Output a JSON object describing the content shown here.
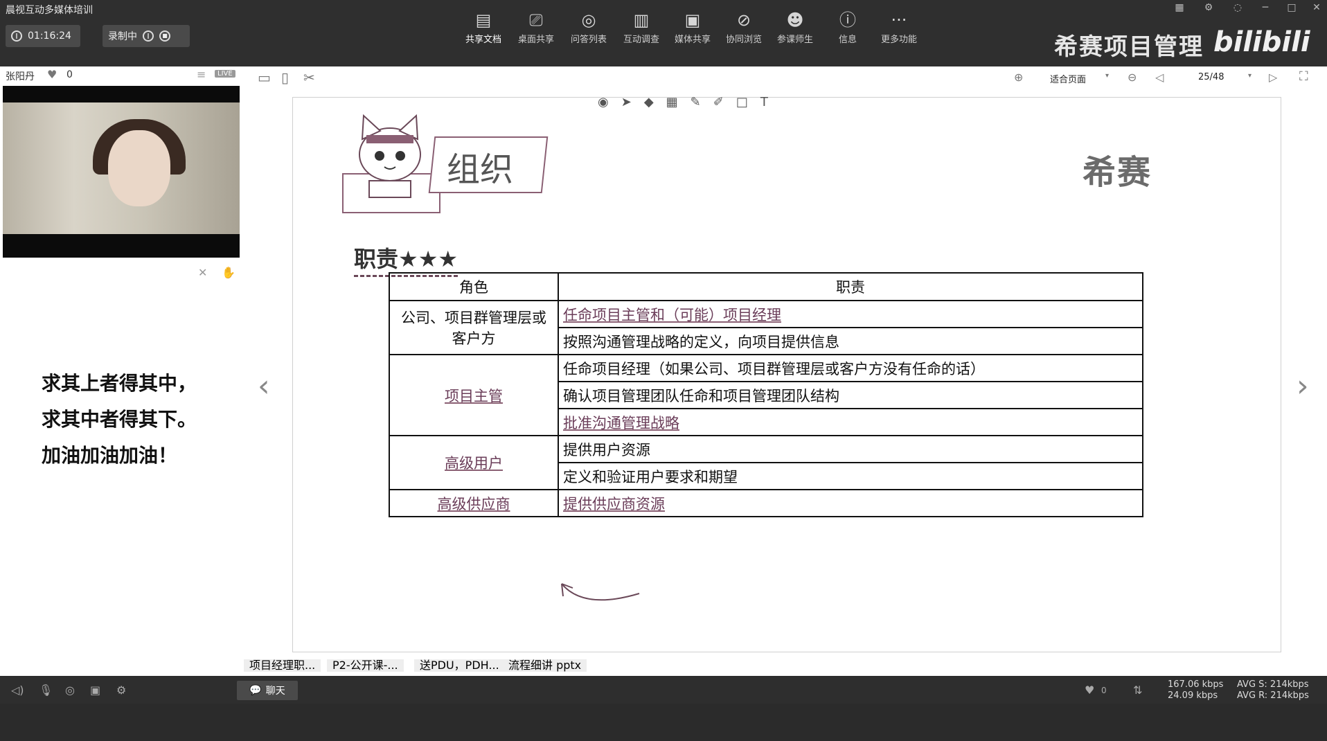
{
  "window": {
    "title": "晨视互动多媒体培训"
  },
  "recording": {
    "timer": "01:16:24",
    "status": "录制中"
  },
  "toolbar": [
    {
      "icon": "document-icon",
      "label": "共享文档"
    },
    {
      "icon": "desktop-share-icon",
      "label": "桌面共享"
    },
    {
      "icon": "qa-icon",
      "label": "问答列表"
    },
    {
      "icon": "survey-icon",
      "label": "互动调查"
    },
    {
      "icon": "media-icon",
      "label": "媒体共享"
    },
    {
      "icon": "browse-icon",
      "label": "协同浏览"
    },
    {
      "icon": "participants-icon",
      "label": "参课师生"
    },
    {
      "icon": "info-icon",
      "label": "信息"
    },
    {
      "icon": "more-icon",
      "label": "更多功能"
    }
  ],
  "brand": {
    "text": "希赛项目管理",
    "platform": "bilibili"
  },
  "presenter": {
    "name": "张阳丹",
    "likes": "0",
    "live_badge": "LIVE"
  },
  "motto": {
    "line1": "求其上者得其中，",
    "line2": "求其中者得其下。",
    "line3": "加油加油加油！"
  },
  "viewer": {
    "fit_label": "适合页面",
    "page": "25/48"
  },
  "slide": {
    "title": "组织",
    "logo": "希赛",
    "subtitle": "职责★★★",
    "table": {
      "headers": {
        "role": "角色",
        "duty": "职责"
      },
      "rows": [
        {
          "role": "公司、项目群管理层或客户方",
          "duty": "任命项目主管和（可能）项目经理"
        },
        {
          "role": "",
          "duty": "按照沟通管理战略的定义，向项目提供信息"
        },
        {
          "role": "项目主管",
          "duty": "任命项目经理（如果公司、项目群管理层或客户方没有任命的话）"
        },
        {
          "role": "",
          "duty": "确认项目管理团队任命和项目管理团队结构"
        },
        {
          "role": "",
          "duty": "批准沟通管理战略"
        },
        {
          "role": "高级用户",
          "duty": "提供用户资源"
        },
        {
          "role": "",
          "duty": "定义和验证用户要求和期望"
        },
        {
          "role": "高级供应商",
          "duty": "提供供应商资源"
        }
      ]
    }
  },
  "files": [
    "项目经理职...",
    "P2-公开课-...",
    "送PDU，PDH...",
    "流程细讲 pptx"
  ],
  "bottom": {
    "chat_label": "聊天",
    "like_count": "0",
    "net_up": "167.06 kbps",
    "net_down": "24.09 kbps",
    "avg_s": "AVG S: 214kbps",
    "avg_r": "AVG R: 214kbps"
  }
}
